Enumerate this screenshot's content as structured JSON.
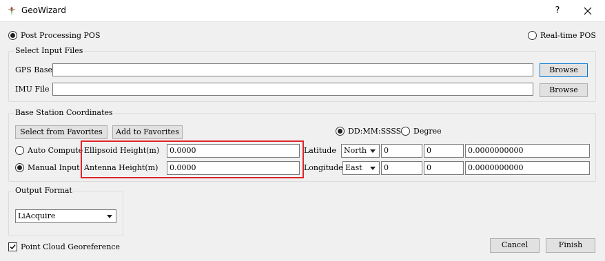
{
  "window": {
    "title": "GeoWizard",
    "help_label": "?",
    "icons": {
      "app": "geowizard-app-icon",
      "close": "close-icon"
    }
  },
  "mode": {
    "post_processing_label": "Post Processing POS",
    "post_processing_selected": true,
    "realtime_label": "Real-time POS",
    "realtime_selected": false
  },
  "input_files": {
    "group_title": "Select Input Files",
    "gps_base_label": "GPS Base",
    "gps_base_value": "",
    "gps_browse_label": "Browse",
    "imu_file_label": "IMU File",
    "imu_file_value": "",
    "imu_browse_label": "Browse"
  },
  "base_station": {
    "group_title": "Base Station Coordinates",
    "select_favorites_label": "Select from Favorites",
    "add_favorites_label": "Add to Favorites",
    "format_dms_label": "DD:MM:SSSSS",
    "format_dms_selected": true,
    "format_degree_label": "Degree",
    "format_degree_selected": false,
    "auto_compute_label": "Auto Compute",
    "auto_compute_selected": false,
    "manual_input_label": "Manual Input",
    "manual_input_selected": true,
    "ellipsoid_height_label": "Ellipsoid Height(m)",
    "ellipsoid_height_value": "0.0000",
    "antenna_height_label": "Antenna Height(m)",
    "antenna_height_value": "0.0000",
    "latitude_label": "Latitude",
    "latitude_hemisphere": "North",
    "latitude_deg": "0",
    "latitude_min": "0",
    "latitude_sec": "0.0000000000",
    "longitude_label": "Longitude",
    "longitude_hemisphere": "East",
    "longitude_deg": "0",
    "longitude_min": "0",
    "longitude_sec": "0.0000000000"
  },
  "output_format": {
    "group_title": "Output Format",
    "selected": "LiAcquire"
  },
  "footer": {
    "point_cloud_label": "Point Cloud Georeference",
    "point_cloud_checked": true,
    "cancel_label": "Cancel",
    "finish_label": "Finish"
  },
  "colors": {
    "highlight": "#e0242a",
    "default_button_border": "#0078d7",
    "dialog_background": "#f0f0f0"
  }
}
